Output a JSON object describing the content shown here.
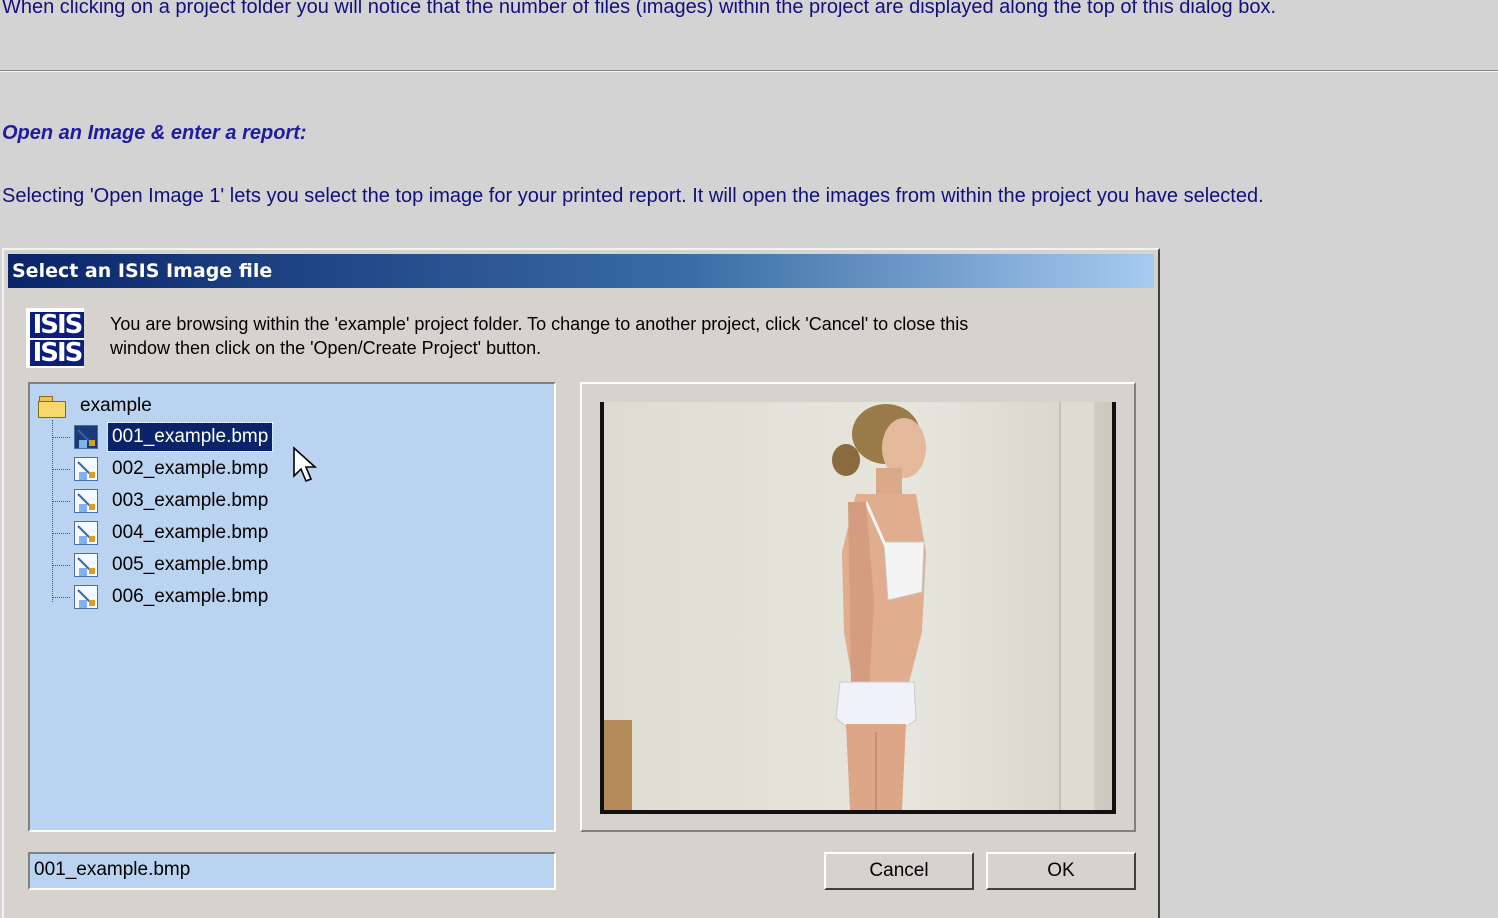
{
  "document": {
    "intro": "When clicking on a project folder you will notice that the number of files (images) within the project are displayed along the top of this dialog box.",
    "heading": "Open an Image & enter a report:",
    "instruction": "Selecting 'Open Image 1' lets you select the top image for your printed report. It will open the images from within the project you have selected."
  },
  "dialog": {
    "title": "Select an ISIS Image file",
    "logo_top": "ISIS",
    "logo_bottom": "ISIS",
    "info_line1": "You are browsing within the 'example' project folder. To change to another project, click 'Cancel' to close this",
    "info_line2": "window then click on the 'Open/Create Project' button.",
    "tree": {
      "root": "example",
      "files": [
        "001_example.bmp",
        "002_example.bmp",
        "003_example.bmp",
        "004_example.bmp",
        "005_example.bmp",
        "006_example.bmp"
      ],
      "selected_index": 0
    },
    "filename_value": "001_example.bmp",
    "cancel_label": "Cancel",
    "ok_label": "OK"
  },
  "icons": {
    "folder": "folder-icon",
    "file": "bitmap-file-icon",
    "cursor": "mouse-pointer-icon",
    "logo": "isis-logo"
  },
  "colors": {
    "doc_text": "#10107c",
    "title_bar": "#0a246a",
    "tree_background": "#bad3f0",
    "selection": "#0a246a"
  }
}
